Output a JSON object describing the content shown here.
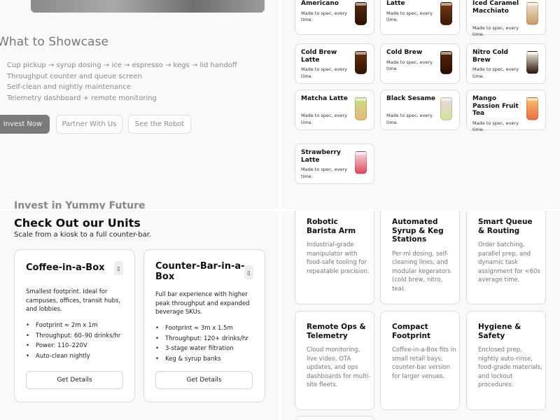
{
  "showcase": {
    "title": "What to Showcase",
    "items": [
      "Cup pickup → syrup dosing → ice → espresso → kegs → lid handoff",
      "Throughput counter and queue screen",
      "Self-clean and nightly maintenance",
      "Telemetry dashboard + remote monitoring"
    ],
    "buttons": {
      "invest": "Invest Now",
      "partner": "Partner With Us",
      "robot": "See the Robot"
    },
    "next_section_title": "Invest in Yummy Future"
  },
  "menu": {
    "desc": "Made to spec, every time.",
    "items": [
      {
        "name": "Americano",
        "color_top": "#5a2a10",
        "color_bottom": "#2a1206"
      },
      {
        "name": "Latte",
        "color_top": "#7a3a15",
        "color_bottom": "#3a1a08"
      },
      {
        "name": "Iced Caramel Macchiato",
        "color_top": "#efe4d2",
        "color_bottom": "#c89a68"
      },
      {
        "name": "Cold Brew Latte",
        "color_top": "#6a3010",
        "color_bottom": "#2e1406"
      },
      {
        "name": "Cold Brew",
        "color_top": "#5a240c",
        "color_bottom": "#2a0f04"
      },
      {
        "name": "Nitro Cold Brew",
        "color_top": "#f3ede3",
        "color_bottom": "#2a1408"
      },
      {
        "name": "Matcha Latte",
        "color_top": "#c9dd8a",
        "color_bottom": "#e6b87a"
      },
      {
        "name": "Black Sesame",
        "color_top": "#f0d4dc",
        "color_bottom": "#cfe59a"
      },
      {
        "name": "Mango Passion Fruit Tea",
        "color_top": "#f7c46a",
        "color_bottom": "#ec6a4a"
      },
      {
        "name": "Strawberry Latte",
        "color_top": "#f6dde2",
        "color_bottom": "#e0465e"
      }
    ]
  },
  "units": {
    "title": "Check Out our Units",
    "subtitle": "Scale from a kiosk to a full counter-bar.",
    "cards": [
      {
        "title": "Coffee-in-a-Box",
        "badge": "▯",
        "desc": "Smallest footprint. Ideal for campuses, offices, transit hubs, and lobbies.",
        "specs": [
          "Footprint ≈ 2m x 1m",
          "Throughput: 60–90 drinks/hr",
          "Power: 110–220V",
          "Auto-clean nightly"
        ],
        "button": "Get Details"
      },
      {
        "title": "Counter-Bar-in-a-Box",
        "badge": "▯",
        "desc": "Full bar experience with higher peak throughput and expanded beverage SKUs.",
        "specs": [
          "Footprint ≈ 3m x 1.5m",
          "Throughput: 120+ drinks/hr",
          "3-stage water filtration",
          "Keg & syrup banks"
        ],
        "button": "Get Details"
      }
    ]
  },
  "features": [
    {
      "title": "Robotic Barista Arm",
      "desc": "Industrial-grade manipulator with food-safe tooling for repeatable precision."
    },
    {
      "title": "Automated Syrup & Keg Stations",
      "desc": "Per-ml dosing, self-cleaning lines, and modular kegerators (cold brew, nitro, tea)."
    },
    {
      "title": "Smart Queue & Routing",
      "desc": "Order batching, parallel prep, and dynamic task assignment for <60s average time."
    },
    {
      "title": "Remote Ops & Telemetry",
      "desc": "Cloud monitoring, live video, OTA updates, and ops dashboards for multi-site fleets."
    },
    {
      "title": "Compact Footprint",
      "desc": "Coffee-in-a-Box fits in small retail bays; counter-bar version for larger venues."
    },
    {
      "title": "Hygiene & Safety",
      "desc": "Enclosed prep, nightly auto-rinse, food-grade materials, and lockout procedures."
    }
  ]
}
